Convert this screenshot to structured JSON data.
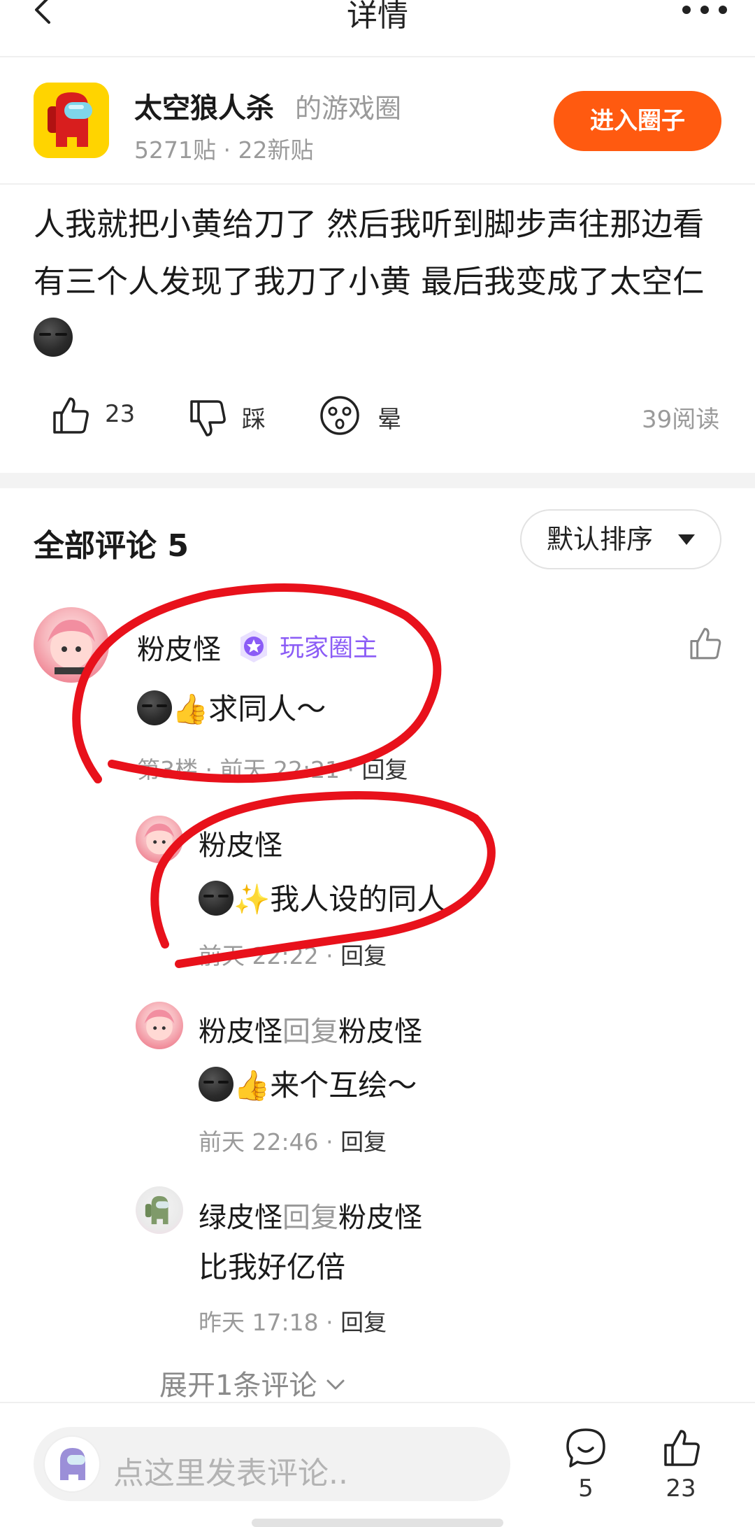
{
  "nav": {
    "title": "详情",
    "back_icon": "chevron-left-icon",
    "more_icon": "more-dots-icon"
  },
  "circle": {
    "name": "太空狼人杀",
    "suffix": "的游戏圈",
    "stats": "5271贴 · 22新贴",
    "join_label": "进入圈子",
    "accent": "#ff5a10"
  },
  "post": {
    "text": "人我就把小黄给刀了 然后我听到脚步声往那边看 有三个人发现了我刀了小黄 最后我变成了太空仁",
    "actions": {
      "like_count": "23",
      "dislike_label": "踩",
      "dizzy_label": "晕",
      "reads": "39阅读"
    }
  },
  "comments": {
    "title": "全部评论 5",
    "sort_label": "默认排序",
    "main": {
      "author": "粉皮怪",
      "badge": "玩家圈主",
      "badge_color": "#8b5cf6",
      "text": "求同人～",
      "meta": "第3楼 · 前天 22:21 · ",
      "reply_label": "回复"
    },
    "replies": [
      {
        "author": "粉皮怪",
        "reply_word": "",
        "reply_to": "",
        "text": "我人设的同人",
        "meta": "前天 22:22 · ",
        "reply_label": "回复"
      },
      {
        "author": "粉皮怪",
        "reply_word": "回复",
        "reply_to": "粉皮怪",
        "text": "来个互绘～",
        "meta": "前天 22:46 · ",
        "reply_label": "回复"
      },
      {
        "author": "绿皮怪",
        "reply_word": "回复",
        "reply_to": "粉皮怪",
        "text": "比我好亿倍",
        "meta": "昨天 17:18 · ",
        "reply_label": "回复"
      }
    ],
    "expand_label": "展开1条评论"
  },
  "bottom_bar": {
    "placeholder": "点这里发表评论..",
    "comment_count": "5",
    "like_count": "23"
  }
}
